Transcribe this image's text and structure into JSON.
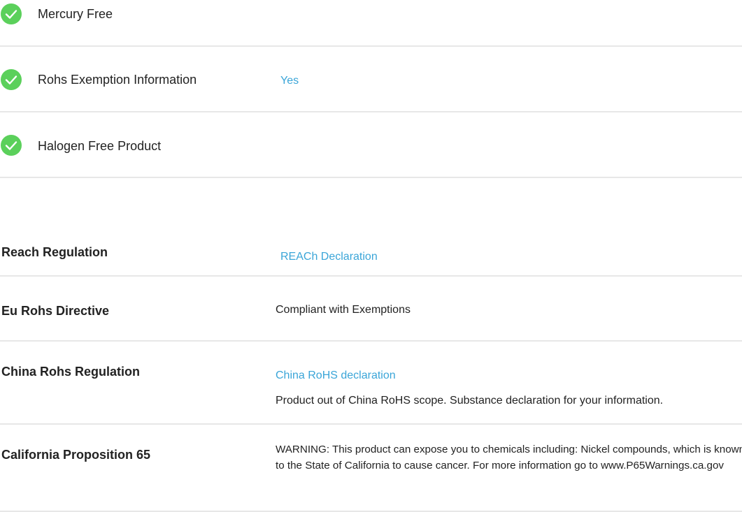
{
  "environmental": {
    "items": [
      {
        "label": "Mercury Free",
        "value": ""
      },
      {
        "label": "Rohs Exemption Information",
        "value": "Yes"
      },
      {
        "label": "Halogen Free Product",
        "value": ""
      }
    ]
  },
  "regulations": {
    "reach": {
      "label": "Reach Regulation",
      "link": "REACh Declaration"
    },
    "eu_rohs": {
      "label": "Eu Rohs Directive",
      "value": "Compliant with Exemptions"
    },
    "china_rohs": {
      "label": "China Rohs Regulation",
      "link": "China RoHS declaration",
      "note": "Product out of China RoHS scope. Substance declaration for your information."
    },
    "prop65": {
      "label": "California Proposition 65",
      "warning": "WARNING: This product can expose you to chemicals including: Nickel compounds, which is known to the State of California to cause cancer. For more information go to www.P65Warnings.ca.gov"
    }
  },
  "colors": {
    "check_green": "#5bd05b",
    "link_blue": "#3aa5d8",
    "divider": "#e7e7e7"
  },
  "icons": {
    "status": "check-circle-icon"
  }
}
